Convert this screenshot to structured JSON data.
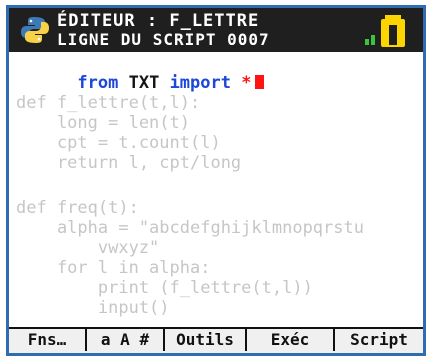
{
  "window": {
    "title_line1": "ÉDITEUR : F_LETTRE",
    "title_line2": "LIGNE DU SCRIPT 0007"
  },
  "icons": {
    "app": "python-logo-icon",
    "battery": "battery-icon"
  },
  "editor": {
    "import_line": {
      "from": "from",
      "module": " TXT ",
      "import": "import",
      "star": " *"
    },
    "lines": [
      "def f_lettre(t,l):",
      "    long = len(t)",
      "    cpt = t.count(l)",
      "    return l, cpt/long",
      "",
      "def freq(t):",
      "    alpha = \"abcdefghijklmnopqrstu",
      "        vwxyz\"",
      "    for l in alpha:",
      "        print (f_lettre(t,l))",
      "        input()"
    ]
  },
  "softkeys": [
    {
      "label": "Fns…"
    },
    {
      "label": "a A #"
    },
    {
      "label": "Outils"
    },
    {
      "label": "Exéc"
    },
    {
      "label": "Script"
    }
  ],
  "colors": {
    "frame_border": "#2d6db0",
    "titlebar": "#1f1f1f",
    "keyword": "#1c47d9",
    "operator": "#ff1212",
    "battery": "#fcd400",
    "battery_mark": "#39c63c"
  }
}
